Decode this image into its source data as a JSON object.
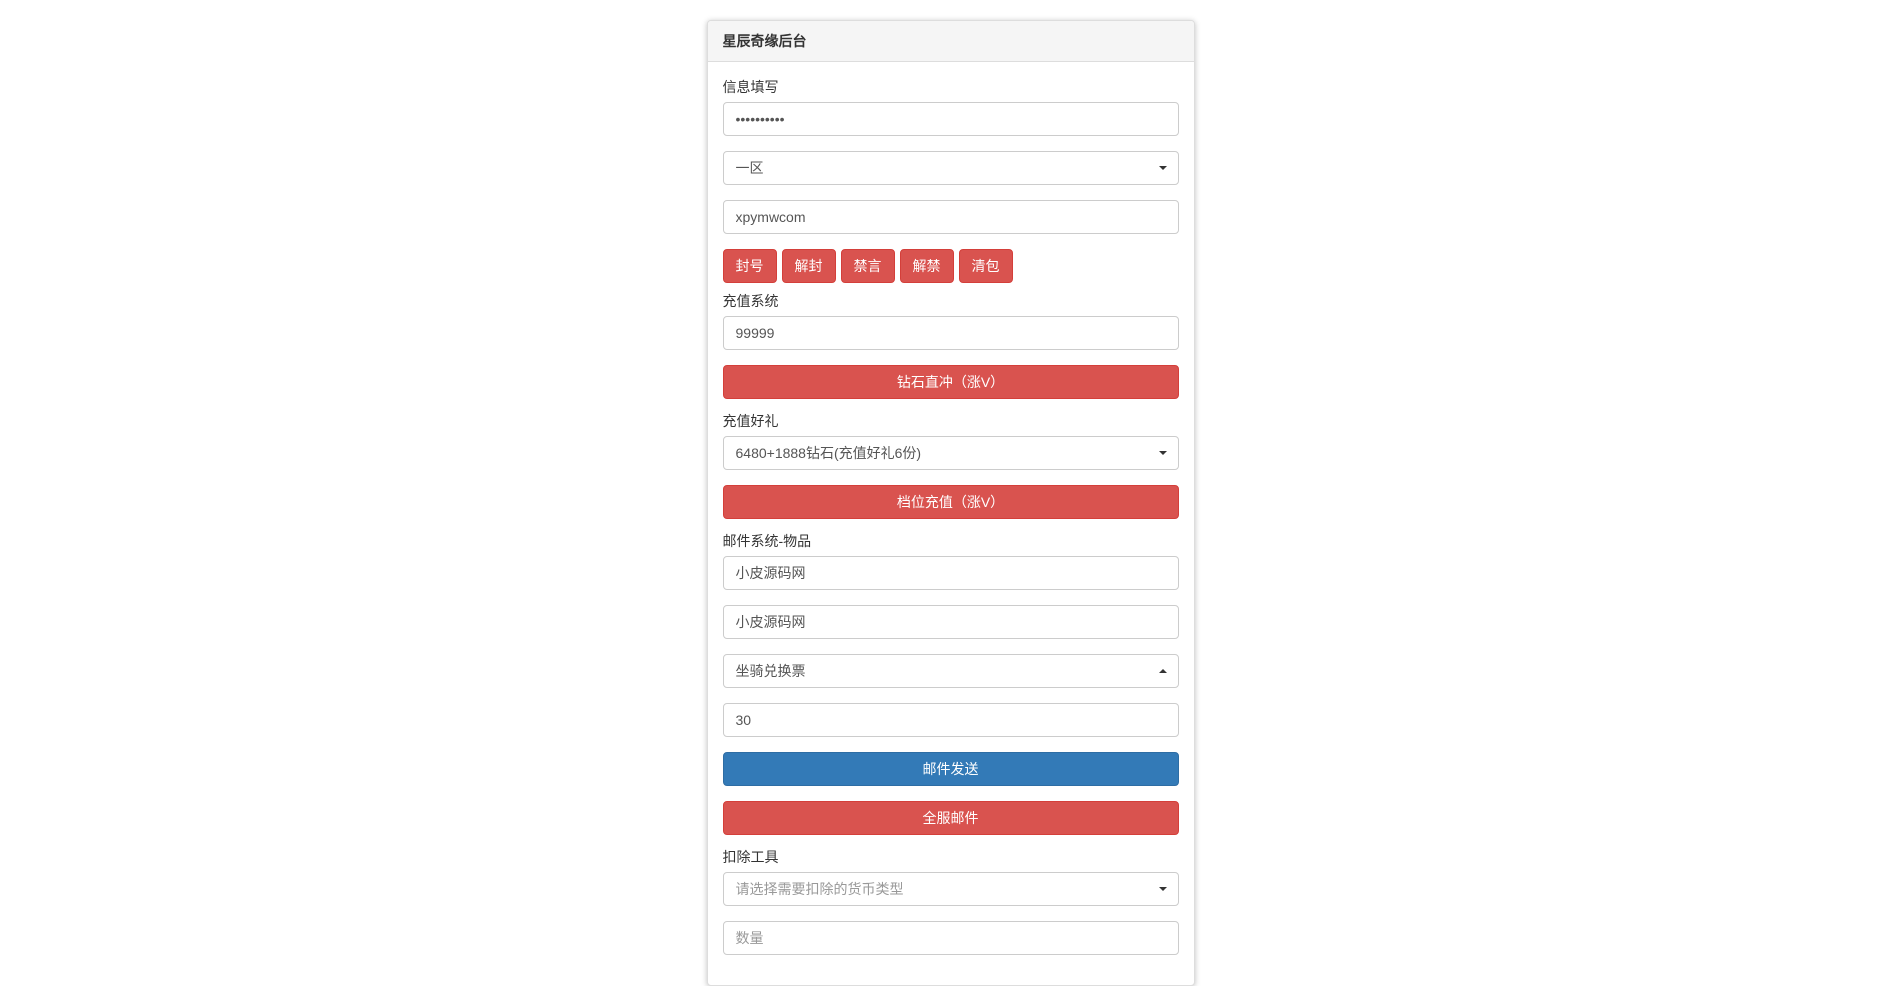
{
  "panel": {
    "title": "星辰奇缘后台"
  },
  "info": {
    "label": "信息填写",
    "password_value": "**********",
    "zone_selected": "一区",
    "username_value": "xpymwcom"
  },
  "actions": {
    "ban": "封号",
    "unban": "解封",
    "mute": "禁言",
    "unmute": "解禁",
    "clearbag": "清包"
  },
  "recharge": {
    "label": "充值系统",
    "amount_value": "99999",
    "direct_btn": "钻石直冲（涨V）",
    "gift_label": "充值好礼",
    "gift_selected": "6480+1888钻石(充值好礼6份)",
    "tier_btn": "档位充值（涨V）"
  },
  "mail": {
    "label": "邮件系统-物品",
    "title_value": "小皮源码网",
    "content_value": "小皮源码网",
    "item_selected": "坐骑兑换票",
    "count_value": "30",
    "send_btn": "邮件发送",
    "global_btn": "全服邮件"
  },
  "deduct": {
    "label": "扣除工具",
    "currency_placeholder": "请选择需要扣除的货币类型",
    "qty_placeholder": "数量"
  }
}
